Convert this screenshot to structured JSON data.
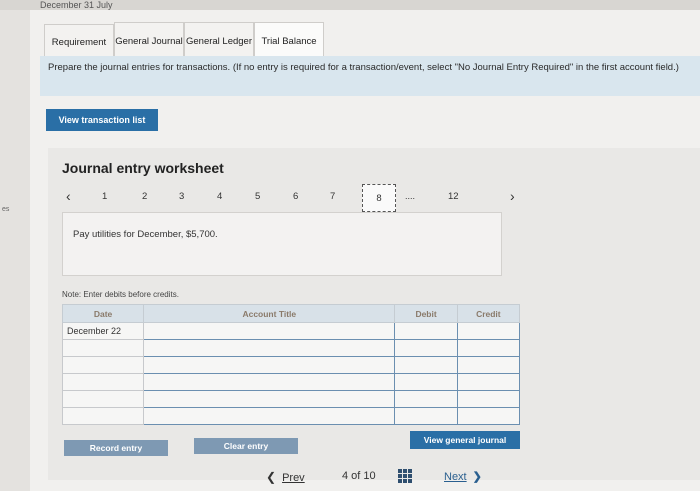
{
  "top_strip_text": "December 31 July",
  "left_edge_text": "es",
  "tabs": [
    {
      "label": "Requirement"
    },
    {
      "label": "General Journal"
    },
    {
      "label": "General Ledger"
    },
    {
      "label": "Trial Balance"
    }
  ],
  "instruction": "Prepare the journal entries for transactions. (If no entry is required for a transaction/event, select \"No Journal Entry Required\" in the first account field.)",
  "view_transaction_list": "View transaction list",
  "worksheet": {
    "title": "Journal entry worksheet",
    "pager": {
      "prev_arrow": "‹",
      "next_arrow": "›",
      "pages": [
        "1",
        "2",
        "3",
        "4",
        "5",
        "6",
        "7",
        "8",
        "12"
      ],
      "active_page": "8",
      "ellipsis": "...."
    },
    "description": "Pay utilities for December, $5,700.",
    "note": "Note: Enter debits before credits.",
    "table": {
      "headers": {
        "date": "Date",
        "account": "Account Title",
        "debit": "Debit",
        "credit": "Credit"
      },
      "rows": [
        {
          "date": "December 22",
          "account": "",
          "debit": "",
          "credit": ""
        },
        {
          "date": "",
          "account": "",
          "debit": "",
          "credit": ""
        },
        {
          "date": "",
          "account": "",
          "debit": "",
          "credit": ""
        },
        {
          "date": "",
          "account": "",
          "debit": "",
          "credit": ""
        },
        {
          "date": "",
          "account": "",
          "debit": "",
          "credit": ""
        },
        {
          "date": "",
          "account": "",
          "debit": "",
          "credit": ""
        }
      ]
    },
    "buttons": {
      "record": "Record entry",
      "clear": "Clear entry",
      "view_general_journal": "View general journal"
    }
  },
  "footer": {
    "prev_label": "Prev",
    "position": "4 of 10",
    "next_label": "Next"
  },
  "colors": {
    "primary_button": "#2a6fa6",
    "instruction_bg": "#d9e6ee"
  }
}
